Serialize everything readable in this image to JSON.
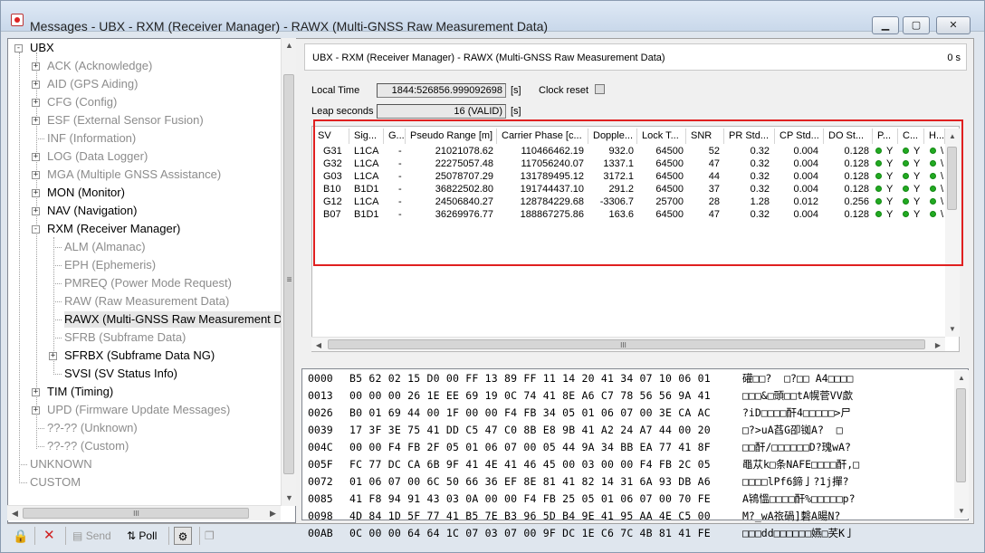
{
  "window": {
    "title": "Messages - UBX - RXM (Receiver Manager) - RAWX (Multi-GNSS Raw Measurement Data)",
    "minimize": "▁",
    "maximize": "▢",
    "close": "✕"
  },
  "tree": {
    "root": "UBX",
    "items": [
      {
        "label": "ACK (Acknowledge)"
      },
      {
        "label": "AID (GPS Aiding)"
      },
      {
        "label": "CFG (Config)"
      },
      {
        "label": "ESF (External Sensor Fusion)"
      },
      {
        "label": "INF (Information)"
      },
      {
        "label": "LOG (Data Logger)"
      },
      {
        "label": "MGA (Multiple GNSS Assistance)"
      },
      {
        "label": "MON (Monitor)"
      },
      {
        "label": "NAV (Navigation)"
      },
      {
        "label": "RXM (Receiver Manager)"
      },
      {
        "label": "ALM (Almanac)"
      },
      {
        "label": "EPH (Ephemeris)"
      },
      {
        "label": "PMREQ (Power Mode Request)"
      },
      {
        "label": "RAW (Raw Measurement Data)"
      },
      {
        "label": "RAWX (Multi-GNSS Raw Measurement Da"
      },
      {
        "label": "SFRB (Subframe Data)"
      },
      {
        "label": "SFRBX (Subframe Data NG)"
      },
      {
        "label": "SVSI (SV Status Info)"
      },
      {
        "label": "TIM (Timing)"
      },
      {
        "label": "UPD (Firmware Update Messages)"
      },
      {
        "label": "??-?? (Unknown)"
      },
      {
        "label": "??-?? (Custom)"
      }
    ],
    "unknown": "UNKNOWN",
    "custom": "CUSTOM",
    "scroll_menu": "≡",
    "scroll_grip": "III"
  },
  "header": {
    "title": "UBX - RXM (Receiver Manager) - RAWX (Multi-GNSS Raw Measurement Data)",
    "age": "0 s"
  },
  "fields": {
    "local_time_label": "Local Time",
    "local_time_value": "1844:526856.999092698",
    "local_time_unit": "[s]",
    "clock_reset_label": "Clock reset",
    "leap_label": "Leap seconds",
    "leap_value": "16 (VALID)",
    "leap_unit": "[s]"
  },
  "table": {
    "headers": [
      "SV",
      "Sig...",
      "G...",
      "Pseudo Range [m]",
      "Carrier Phase [c...",
      "Dopple...",
      "Lock T...",
      "SNR",
      "PR Std...",
      "CP Std...",
      "DO St...",
      "P...",
      "C...",
      "H..."
    ],
    "rows": [
      {
        "sv": "G31",
        "sig": "L1CA",
        "g": "-",
        "pr": "21021078.62",
        "cp": "110466462.19",
        "dop": "932.0",
        "lock": "64500",
        "snr": "52",
        "prstd": "0.32",
        "cpstd": "0.004",
        "dostd": "0.128",
        "p": "Y",
        "c": "Y"
      },
      {
        "sv": "G32",
        "sig": "L1CA",
        "g": "-",
        "pr": "22275057.48",
        "cp": "117056240.07",
        "dop": "1337.1",
        "lock": "64500",
        "snr": "47",
        "prstd": "0.32",
        "cpstd": "0.004",
        "dostd": "0.128",
        "p": "Y",
        "c": "Y"
      },
      {
        "sv": "G03",
        "sig": "L1CA",
        "g": "-",
        "pr": "25078707.29",
        "cp": "131789495.12",
        "dop": "3172.1",
        "lock": "64500",
        "snr": "44",
        "prstd": "0.32",
        "cpstd": "0.004",
        "dostd": "0.128",
        "p": "Y",
        "c": "Y"
      },
      {
        "sv": "B10",
        "sig": "B1D1",
        "g": "-",
        "pr": "36822502.80",
        "cp": "191744437.10",
        "dop": "291.2",
        "lock": "64500",
        "snr": "37",
        "prstd": "0.32",
        "cpstd": "0.004",
        "dostd": "0.128",
        "p": "Y",
        "c": "Y"
      },
      {
        "sv": "G12",
        "sig": "L1CA",
        "g": "-",
        "pr": "24506840.27",
        "cp": "128784229.68",
        "dop": "-3306.7",
        "lock": "25700",
        "snr": "28",
        "prstd": "1.28",
        "cpstd": "0.012",
        "dostd": "0.256",
        "p": "Y",
        "c": "Y"
      },
      {
        "sv": "B07",
        "sig": "B1D1",
        "g": "-",
        "pr": "36269976.77",
        "cp": "188867275.86",
        "dop": "163.6",
        "lock": "64500",
        "snr": "47",
        "prstd": "0.32",
        "cpstd": "0.004",
        "dostd": "0.128",
        "p": "Y",
        "c": "Y"
      }
    ],
    "row_tail": "\\",
    "scroll_grip": "III"
  },
  "hex": [
    {
      "addr": "0000",
      "bytes": "B5 62 02 15 D0 00 FF 13 89 FF 11 14 20 41 34 07 10 06 01",
      "ascii": "礶□□?  □?□□ A4□□□□"
    },
    {
      "addr": "0013",
      "bytes": "00 00 00 26 1E EE 69 19 0C 74 41 8E A6 C7 78 56 56 9A 41",
      "ascii": "□□□&□頭□□tA幌菅VV歔"
    },
    {
      "addr": "0026",
      "bytes": "B0 01 69 44 00 1F 00 00 F4 FB 34 05 01 06 07 00 3E CA AC",
      "ascii": "?iD□□□□酐4□□□□□>尸"
    },
    {
      "addr": "0039",
      "bytes": "17 3F 3E 75 41 DD C5 47 C0 8B E8 9B 41 A2 24 A7 44 00 20",
      "ascii": "□?>uA萏G卲铷A?  □"
    },
    {
      "addr": "004C",
      "bytes": "00 00 F4 FB 2F 05 01 06 07 00 05 44 9A 34 BB EA 77 41 8F",
      "ascii": "□□酐/□□□□□□D?瑰wA?"
    },
    {
      "addr": "005F",
      "bytes": "FC 77 DC CA 6B 9F 41 4E 41 46 45 00 03 00 00 F4 FB 2C 05",
      "ascii": "黽苁k□条NAFE□□□□酐,□"
    },
    {
      "addr": "0072",
      "bytes": "01 06 07 00 6C 50 66 36 EF 8E 81 41 82 14 31 6A 93 DB A6",
      "ascii": "□□□□lPf6鍗亅?1j撣?"
    },
    {
      "addr": "0085",
      "bytes": "41 F8 94 91 43 03 0A 00 00 F4 FB 25 05 01 06 07 00 70 FE",
      "ascii": "A鴇慍□□□□酐%□□□□□p?"
    },
    {
      "addr": "0098",
      "bytes": "4D 84 1D 5F 77 41 B5 7E B3 96 5D B4 9E 41 95 AA 4E C5 00",
      "ascii": "M?_wA祣碢]礊A暘N?"
    },
    {
      "addr": "00AB",
      "bytes": "0C 00 00 64 64 1C 07 03 07 00 9F DC 1E C6 7C 4B 81 41 FE",
      "ascii": "□□□dd□□□□□□嬿□芺K亅"
    }
  ],
  "toolbar": {
    "send": "Send",
    "poll": "Poll"
  },
  "colors": {
    "highlight_border": "#e02020",
    "status_dot": "#22aa22",
    "selected_bg": "#e6e6e6"
  }
}
